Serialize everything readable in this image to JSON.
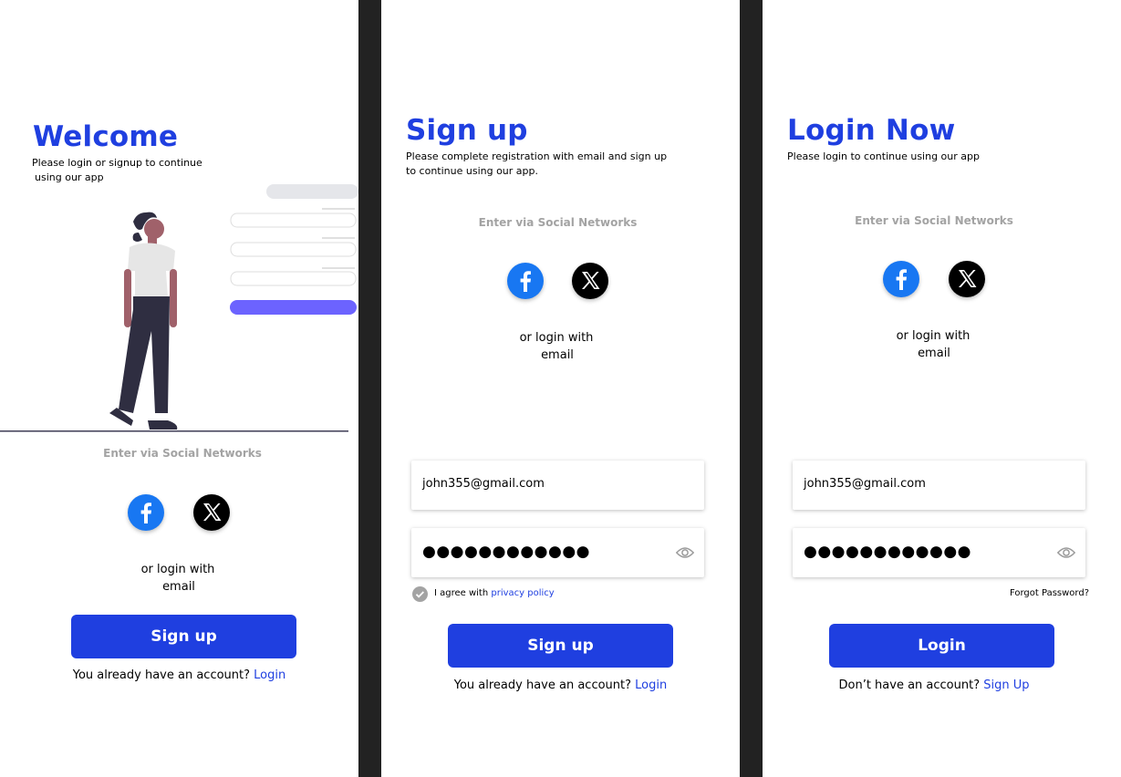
{
  "welcome": {
    "title": "Welcome",
    "subtitle_line1": "Please login or signup to continue",
    "subtitle_line2": "using our app",
    "social_heading": "Enter via Social Networks",
    "or_line1": "or login with",
    "or_line2": "email",
    "signup_button": "Sign up",
    "footer_text": "You already have an account?",
    "footer_link": "Login"
  },
  "signup": {
    "title": "Sign up",
    "subtitle_line1": "Please complete registration with email and sign up",
    "subtitle_line2": "to continue using our app.",
    "social_heading": "Enter via Social Networks",
    "or_line1": "or login with",
    "or_line2": "email",
    "email_value": "john355@gmail.com",
    "password_mask": "●●●●●●●●●●●●",
    "agree_text": "I agree with",
    "agree_link": "privacy policy",
    "signup_button": "Sign up",
    "footer_text": "You already have an account?",
    "footer_link": "Login"
  },
  "login": {
    "title": "Login Now",
    "subtitle": "Please login to continue using our app",
    "social_heading": "Enter via Social Networks",
    "or_line1": "or login with",
    "or_line2": "email",
    "email_value": "john355@gmail.com",
    "password_mask": "●●●●●●●●●●●●",
    "forgot_password": "Forgot Password?",
    "login_button": "Login",
    "footer_text": "Don’t have an account?",
    "footer_link": "Sign Up"
  },
  "colors": {
    "accent": "#1f3fe0",
    "facebook": "#1877f2",
    "x": "#000000",
    "muted": "#a3a3a3",
    "divider": "#222222",
    "illustration_button": "#6c63ff"
  },
  "icons": [
    "facebook-icon",
    "x-icon",
    "eye-icon",
    "check-icon"
  ]
}
